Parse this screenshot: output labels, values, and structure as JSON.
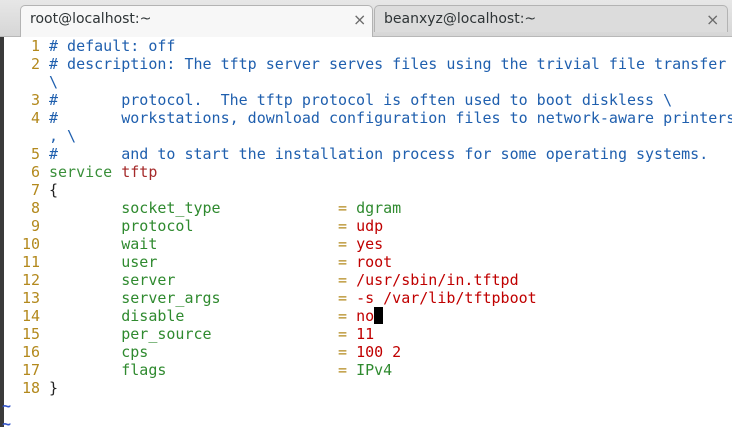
{
  "tabs": [
    {
      "title": "root@localhost:~",
      "close": "×"
    },
    {
      "title": "beanxyz@localhost:~",
      "close": "×"
    }
  ],
  "lines": [
    {
      "num": "1",
      "parts": [
        {
          "t": "# default: off",
          "c": "cmt"
        }
      ]
    },
    {
      "num": "2",
      "parts": [
        {
          "t": "# description: The tftp server serves files using the trivial file transfer",
          "c": "cmt"
        }
      ]
    },
    {
      "num": "",
      "parts": [
        {
          "t": "\\",
          "c": "cmt"
        }
      ]
    },
    {
      "num": "3",
      "parts": [
        {
          "t": "#       protocol.  The tftp protocol is often used to boot diskless \\",
          "c": "cmt"
        }
      ]
    },
    {
      "num": "4",
      "parts": [
        {
          "t": "#       workstations, download configuration files to network-aware printers",
          "c": "cmt"
        }
      ]
    },
    {
      "num": "",
      "parts": [
        {
          "t": ", \\",
          "c": "cmt"
        }
      ]
    },
    {
      "num": "5",
      "parts": [
        {
          "t": "#       and to start the installation process for some operating systems.",
          "c": "cmt"
        }
      ]
    },
    {
      "num": "6",
      "parts": [
        {
          "t": "service",
          "c": "kw"
        },
        {
          "t": " ",
          "c": "plain"
        },
        {
          "t": "tftp",
          "c": "id"
        }
      ]
    },
    {
      "num": "7",
      "parts": [
        {
          "t": "{",
          "c": "plain"
        }
      ]
    },
    {
      "num": "8",
      "parts": [
        {
          "t": "        ",
          "c": "plain"
        },
        {
          "t": "socket_type",
          "c": "key"
        },
        {
          "t": "             ",
          "c": "plain"
        },
        {
          "t": "=",
          "c": "op"
        },
        {
          "t": " ",
          "c": "plain"
        },
        {
          "t": "dgram",
          "c": "key"
        }
      ]
    },
    {
      "num": "9",
      "parts": [
        {
          "t": "        ",
          "c": "plain"
        },
        {
          "t": "protocol",
          "c": "key"
        },
        {
          "t": "                ",
          "c": "plain"
        },
        {
          "t": "=",
          "c": "op"
        },
        {
          "t": " ",
          "c": "plain"
        },
        {
          "t": "udp",
          "c": "val"
        }
      ]
    },
    {
      "num": "10",
      "parts": [
        {
          "t": "        ",
          "c": "plain"
        },
        {
          "t": "wait",
          "c": "key"
        },
        {
          "t": "                    ",
          "c": "plain"
        },
        {
          "t": "=",
          "c": "op"
        },
        {
          "t": " ",
          "c": "plain"
        },
        {
          "t": "yes",
          "c": "val"
        }
      ]
    },
    {
      "num": "11",
      "parts": [
        {
          "t": "        ",
          "c": "plain"
        },
        {
          "t": "user",
          "c": "key"
        },
        {
          "t": "                    ",
          "c": "plain"
        },
        {
          "t": "=",
          "c": "op"
        },
        {
          "t": " ",
          "c": "plain"
        },
        {
          "t": "root",
          "c": "val"
        }
      ]
    },
    {
      "num": "12",
      "parts": [
        {
          "t": "        ",
          "c": "plain"
        },
        {
          "t": "server",
          "c": "key"
        },
        {
          "t": "                  ",
          "c": "plain"
        },
        {
          "t": "=",
          "c": "op"
        },
        {
          "t": " ",
          "c": "plain"
        },
        {
          "t": "/usr/sbin/in.tftpd",
          "c": "val"
        }
      ]
    },
    {
      "num": "13",
      "parts": [
        {
          "t": "        ",
          "c": "plain"
        },
        {
          "t": "server_args",
          "c": "key"
        },
        {
          "t": "             ",
          "c": "plain"
        },
        {
          "t": "=",
          "c": "op"
        },
        {
          "t": " ",
          "c": "plain"
        },
        {
          "t": "-s /var/lib/tftpboot",
          "c": "val"
        }
      ]
    },
    {
      "num": "14",
      "parts": [
        {
          "t": "        ",
          "c": "plain"
        },
        {
          "t": "disable",
          "c": "key"
        },
        {
          "t": "                 ",
          "c": "plain"
        },
        {
          "t": "=",
          "c": "op"
        },
        {
          "t": " ",
          "c": "plain"
        },
        {
          "t": "no",
          "c": "val"
        }
      ],
      "cursor": true
    },
    {
      "num": "15",
      "parts": [
        {
          "t": "        ",
          "c": "plain"
        },
        {
          "t": "per_source",
          "c": "key"
        },
        {
          "t": "              ",
          "c": "plain"
        },
        {
          "t": "=",
          "c": "op"
        },
        {
          "t": " ",
          "c": "plain"
        },
        {
          "t": "11",
          "c": "val"
        }
      ]
    },
    {
      "num": "16",
      "parts": [
        {
          "t": "        ",
          "c": "plain"
        },
        {
          "t": "cps",
          "c": "key"
        },
        {
          "t": "                     ",
          "c": "plain"
        },
        {
          "t": "=",
          "c": "op"
        },
        {
          "t": " ",
          "c": "plain"
        },
        {
          "t": "100 2",
          "c": "val"
        }
      ]
    },
    {
      "num": "17",
      "parts": [
        {
          "t": "        ",
          "c": "plain"
        },
        {
          "t": "flags",
          "c": "key"
        },
        {
          "t": "                   ",
          "c": "plain"
        },
        {
          "t": "=",
          "c": "op"
        },
        {
          "t": " ",
          "c": "plain"
        },
        {
          "t": "IPv4",
          "c": "key"
        }
      ]
    },
    {
      "num": "18",
      "parts": [
        {
          "t": "}",
          "c": "plain"
        }
      ]
    }
  ],
  "empty_marker": "~",
  "empty_lines": 2
}
